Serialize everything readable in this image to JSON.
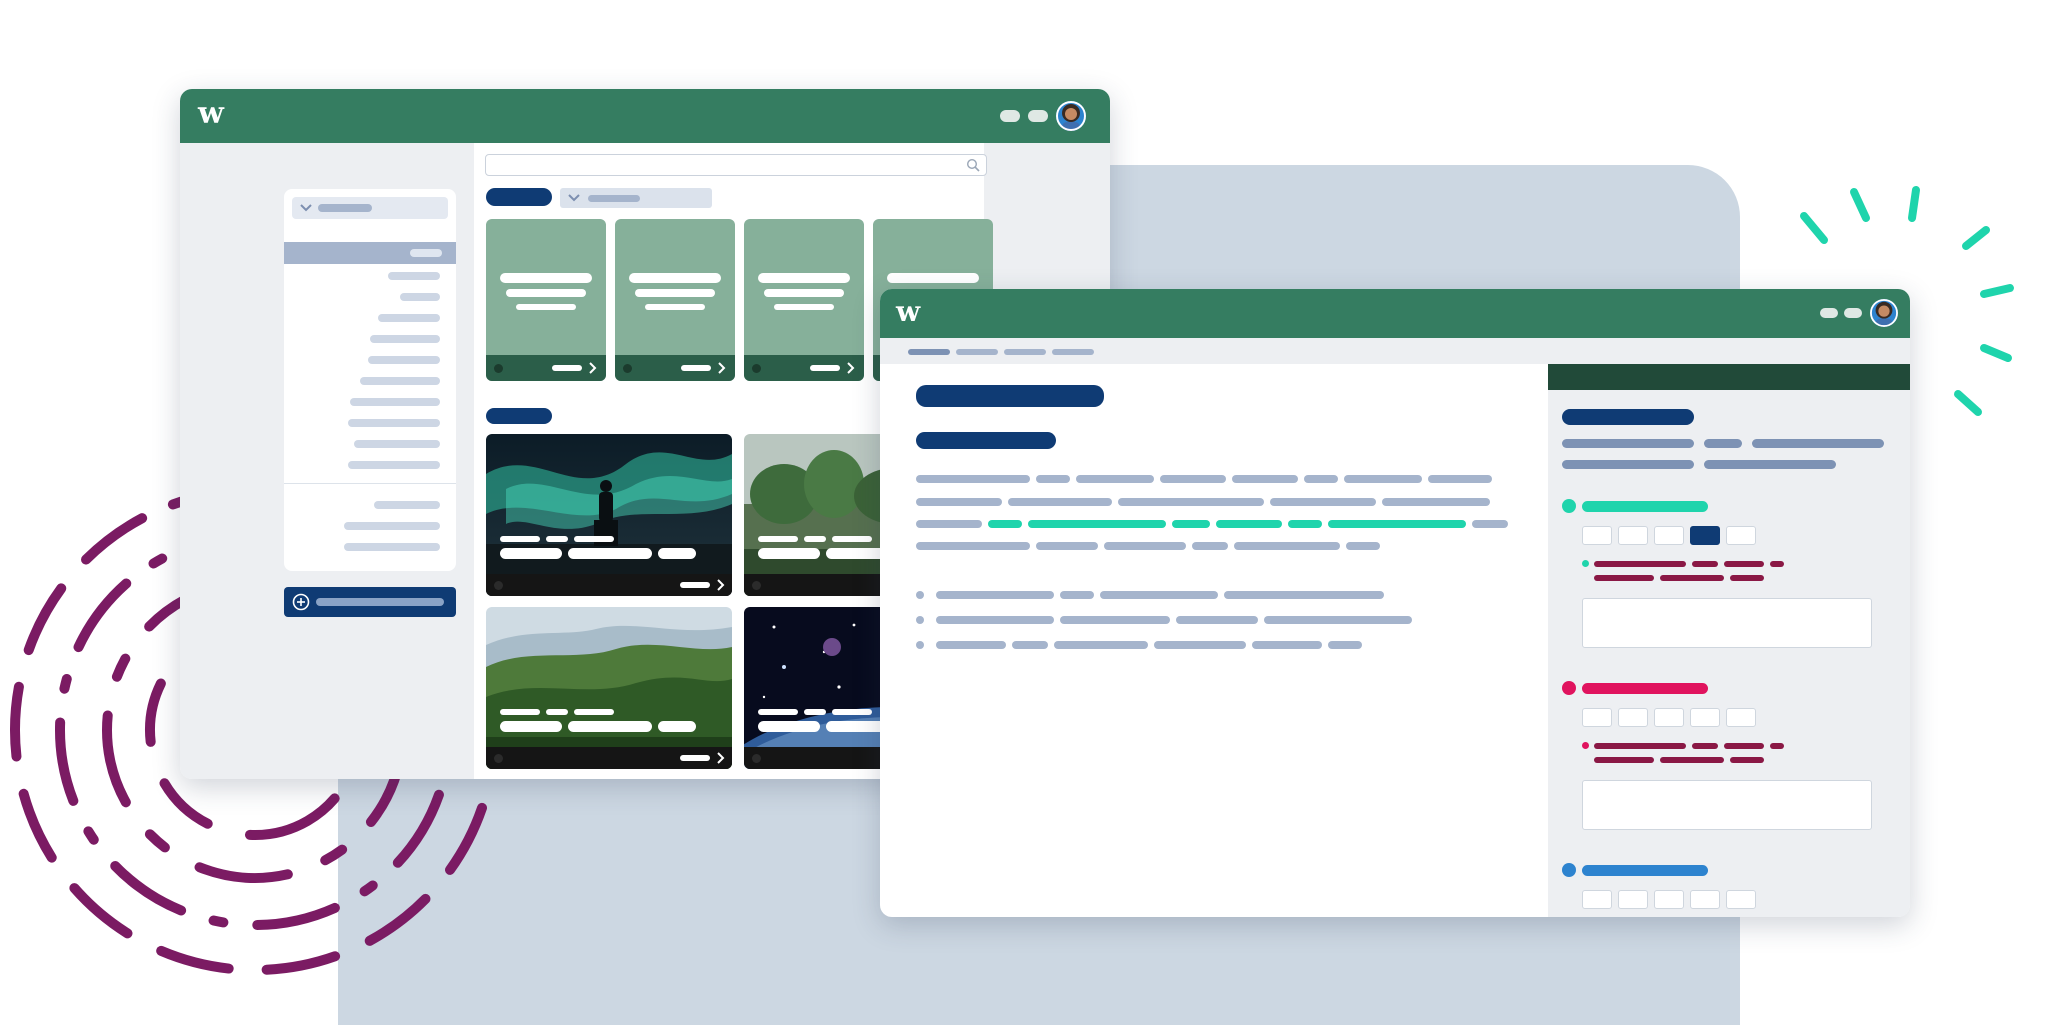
{
  "colors": {
    "brand_green": "#357d61",
    "dark_green": "#214a39",
    "navy": "#0f3b74",
    "teal": "#1fd4ac",
    "pink": "#e0135e",
    "blue": "#2d83cf",
    "maroon": "#8a1845",
    "purple_deco": "#7b1b63",
    "placeholder_gray": "#a5b4cc",
    "panel_bg": "#ccd7e2"
  },
  "icons": {
    "logo": "wavy-w-logo",
    "search": "search-icon",
    "chevron": "chevron-down-icon",
    "add": "plus-circle-icon",
    "arrow": "chevron-right-icon",
    "avatar": "user-avatar"
  },
  "brand": {
    "logo_glyph": "w"
  },
  "win1": {
    "gallery_cards": [
      {
        "name": "aurora-silhouette-card",
        "image": "aurora-night-sky"
      },
      {
        "name": "tall-trees-card",
        "image": "misty-forest"
      },
      {
        "name": "forest-hills-card",
        "image": "green-forest-hills"
      },
      {
        "name": "space-planets-card",
        "image": "space-earth-planets"
      }
    ]
  },
  "win2": {
    "option_sets": [
      {
        "accent": "teal",
        "selected_index": 3
      },
      {
        "accent": "pink",
        "selected_index": -1
      },
      {
        "accent": "blue",
        "selected_index": -1
      }
    ]
  }
}
